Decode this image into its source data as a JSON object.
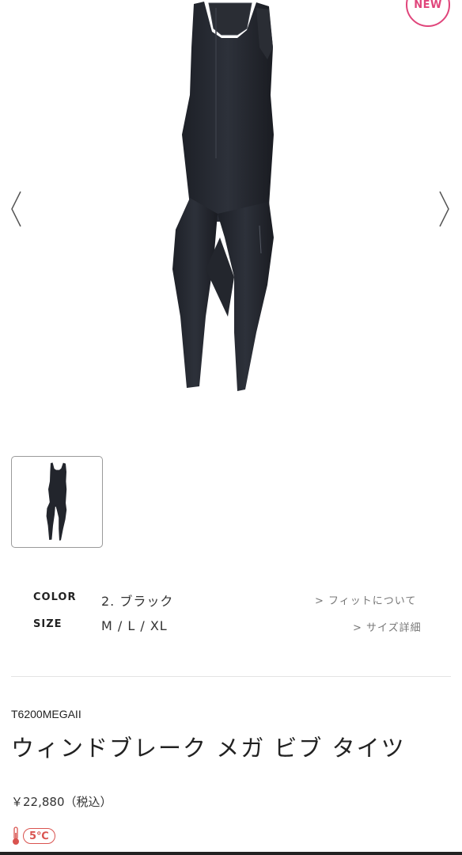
{
  "badge": {
    "label": "NEW"
  },
  "hero": {
    "image": "black-sleeveless-bib-tights"
  },
  "specs": {
    "color_label": "COLOR",
    "color_value": "2. ブラック",
    "fit_link": "> フィットについて",
    "size_label": "SIZE",
    "size_value": "M / L / XL",
    "size_link": "> サイズ詳細"
  },
  "product": {
    "model": "T6200MEGAII",
    "title": "ウィンドブレーク メガ ビブ タイツ",
    "price": "￥22,880（税込）",
    "temperature": "5℃"
  },
  "icons": {
    "prev": "chevron-left-icon",
    "next": "chevron-right-icon",
    "thermometer": "thermometer-icon"
  },
  "colors": {
    "accent_pink": "#e0457b",
    "temp_red": "#d9534f"
  }
}
